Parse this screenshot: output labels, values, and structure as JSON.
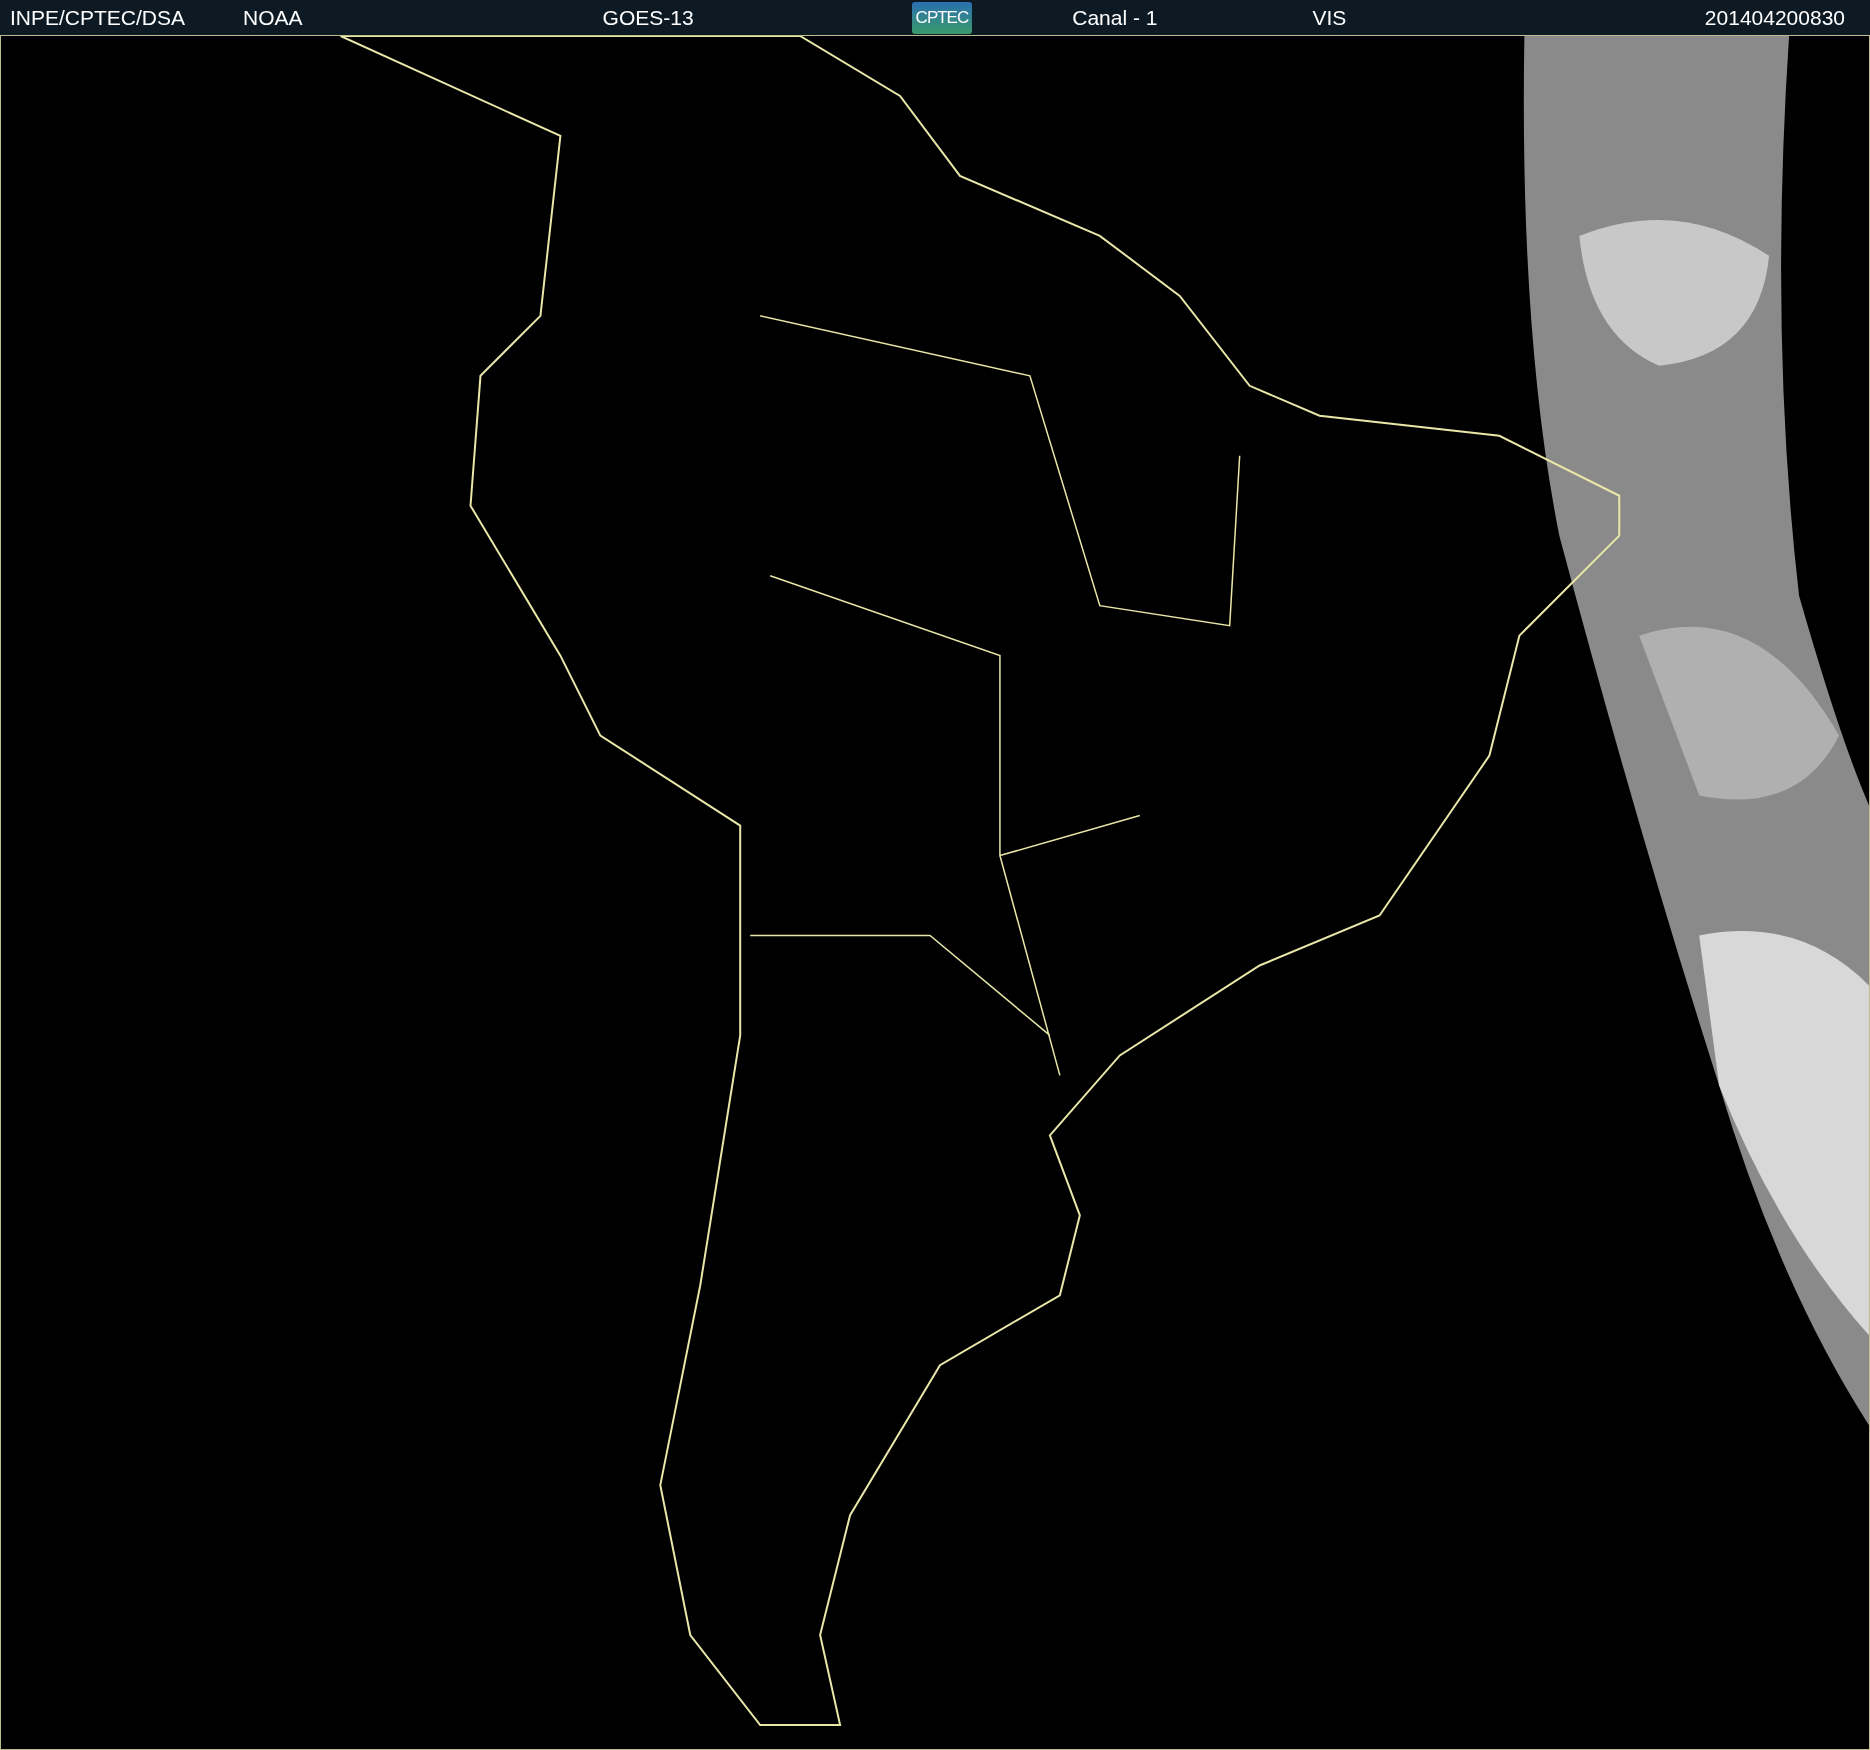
{
  "header": {
    "items": [
      {
        "kind": "text",
        "text": "INPE/CPTEC/DSA"
      },
      {
        "kind": "text",
        "text": "NOAA"
      },
      {
        "kind": "text",
        "text": "GOES-13"
      },
      {
        "kind": "logo",
        "text": "CPTEC"
      },
      {
        "kind": "text",
        "text": "Canal - 1"
      },
      {
        "kind": "text",
        "text": "VIS"
      },
      {
        "kind": "text",
        "text": "201404200830"
      }
    ]
  }
}
